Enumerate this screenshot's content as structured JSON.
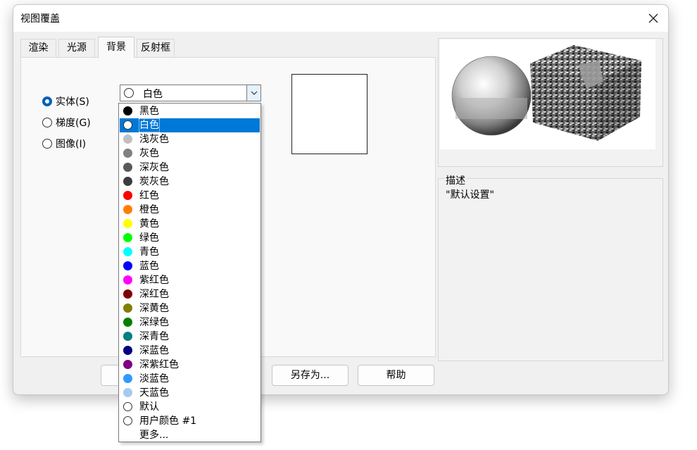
{
  "window": {
    "title": "视图覆盖"
  },
  "tabs": [
    {
      "label": "渲染"
    },
    {
      "label": "光源"
    },
    {
      "label": "背景"
    },
    {
      "label": "反射框"
    }
  ],
  "background_type": {
    "solid_label": "实体(S)",
    "gradient_label": "梯度(G)",
    "image_label": "图像(I)",
    "selected": "实体(S)"
  },
  "color_combo": {
    "value": "白色"
  },
  "color_options": [
    {
      "label": "黑色",
      "color": "#000000"
    },
    {
      "label": "白色",
      "color": "#ffffff"
    },
    {
      "label": "浅灰色",
      "color": "#c0c0c0"
    },
    {
      "label": "灰色",
      "color": "#808080"
    },
    {
      "label": "深灰色",
      "color": "#5a5a5a"
    },
    {
      "label": "炭灰色",
      "color": "#3c3c3c"
    },
    {
      "label": "红色",
      "color": "#ff0000"
    },
    {
      "label": "橙色",
      "color": "#ff7f00"
    },
    {
      "label": "黄色",
      "color": "#ffff00"
    },
    {
      "label": "绿色",
      "color": "#00ff00"
    },
    {
      "label": "青色",
      "color": "#00ffff"
    },
    {
      "label": "蓝色",
      "color": "#0000ff"
    },
    {
      "label": "紫红色",
      "color": "#ff00ff"
    },
    {
      "label": "深红色",
      "color": "#800000"
    },
    {
      "label": "深黄色",
      "color": "#808000"
    },
    {
      "label": "深绿色",
      "color": "#008000"
    },
    {
      "label": "深青色",
      "color": "#008080"
    },
    {
      "label": "深蓝色",
      "color": "#000080"
    },
    {
      "label": "深紫红色",
      "color": "#800080"
    },
    {
      "label": "淡蓝色",
      "color": "#3399ff"
    },
    {
      "label": "天蓝色",
      "color": "#a6caf0"
    },
    {
      "label": "默认",
      "color": "#ffffff"
    },
    {
      "label": "用户颜色 #1",
      "color": "#ffffff"
    },
    {
      "label": "更多...",
      "color": ""
    }
  ],
  "selected_option": "白色",
  "description": {
    "label": "描述",
    "text": "\"默认设置\""
  },
  "buttons": {
    "save_as": "另存为...",
    "help": "帮助"
  },
  "colors": {
    "accent": "#0078d7",
    "radio_checked": "#005fb8"
  }
}
